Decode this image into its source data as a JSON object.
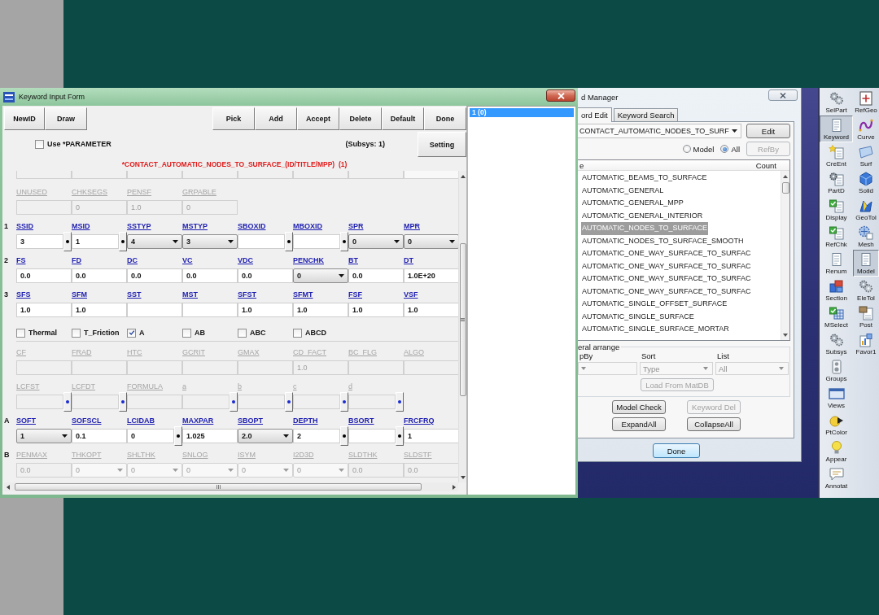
{
  "keyword_input_form": {
    "title": "Keyword Input Form",
    "buttons_left": [
      "NewID",
      "Draw"
    ],
    "buttons_right": [
      "Pick",
      "Add",
      "Accept",
      "Delete",
      "Default",
      "Done"
    ],
    "use_parameter": {
      "label": "Use *PARAMETER",
      "checked": false
    },
    "subsys": "(Subsys: 1)",
    "setting_button": "Setting",
    "keyword_title": "*CONTACT_AUTOMATIC_NODES_TO_SURFACE_(ID/TITLE/MPP)  (1)",
    "sections": [
      {
        "kind": "clipped",
        "fields": [
          {
            "kind": "text"
          },
          {
            "kind": "text"
          },
          {
            "kind": "text"
          },
          {
            "kind": "text"
          },
          {
            "kind": "text"
          },
          {
            "kind": "text"
          },
          {
            "kind": "text"
          },
          {
            "kind": "select"
          }
        ]
      },
      {
        "kind": "card",
        "disabled": true,
        "fields": [
          {
            "label": "UNUSED",
            "kind": "text"
          },
          {
            "label": "CHKSEGS",
            "kind": "text",
            "value": "0"
          },
          {
            "label": "PENSF",
            "kind": "text",
            "value": "1.0"
          },
          {
            "label": "GRPABLE",
            "kind": "text",
            "value": "0"
          }
        ]
      },
      {
        "kind": "card",
        "row_label": "1",
        "disabled": false,
        "fields": [
          {
            "label": "SSID",
            "kind": "pick",
            "value": "3"
          },
          {
            "label": "MSID",
            "kind": "pick",
            "value": "1"
          },
          {
            "label": "SSTYP",
            "kind": "select",
            "value": "4"
          },
          {
            "label": "MSTYP",
            "kind": "select",
            "value": "3"
          },
          {
            "label": "SBOXID",
            "kind": "pick"
          },
          {
            "label": "MBOXID",
            "kind": "pick"
          },
          {
            "label": "SPR",
            "kind": "select",
            "value": "0"
          },
          {
            "label": "MPR",
            "kind": "select",
            "value": "0"
          }
        ]
      },
      {
        "kind": "card",
        "row_label": "2",
        "disabled": false,
        "fields": [
          {
            "label": "FS",
            "kind": "text",
            "value": "0.0"
          },
          {
            "label": "FD",
            "kind": "text",
            "value": "0.0"
          },
          {
            "label": "DC",
            "kind": "text",
            "value": "0.0"
          },
          {
            "label": "VC",
            "kind": "text",
            "value": "0.0"
          },
          {
            "label": "VDC",
            "kind": "text",
            "value": "0.0"
          },
          {
            "label": "PENCHK",
            "kind": "select",
            "value": "0"
          },
          {
            "label": "BT",
            "kind": "text",
            "value": "0.0"
          },
          {
            "label": "DT",
            "kind": "text",
            "value": "1.0E+20"
          }
        ]
      },
      {
        "kind": "card",
        "row_label": "3",
        "disabled": false,
        "fields": [
          {
            "label": "SFS",
            "kind": "text",
            "value": "1.0"
          },
          {
            "label": "SFM",
            "kind": "text",
            "value": "1.0"
          },
          {
            "label": "SST",
            "kind": "text"
          },
          {
            "label": "MST",
            "kind": "text"
          },
          {
            "label": "SFST",
            "kind": "text",
            "value": "1.0"
          },
          {
            "label": "SFMT",
            "kind": "text",
            "value": "1.0"
          },
          {
            "label": "FSF",
            "kind": "text",
            "value": "1.0"
          },
          {
            "label": "VSF",
            "kind": "text",
            "value": "1.0"
          }
        ]
      },
      {
        "kind": "options",
        "items": [
          {
            "label": "Thermal",
            "checked": false
          },
          {
            "label": "T_Friction",
            "checked": false
          },
          {
            "label": "A",
            "checked": true
          },
          {
            "label": "AB",
            "checked": false
          },
          {
            "label": "ABC",
            "checked": false
          },
          {
            "label": "ABCD",
            "checked": false
          }
        ]
      },
      {
        "kind": "card",
        "disabled": true,
        "fields": [
          {
            "label": "CF",
            "kind": "text"
          },
          {
            "label": "FRAD",
            "kind": "text"
          },
          {
            "label": "HTC",
            "kind": "text"
          },
          {
            "label": "GCRIT",
            "kind": "text"
          },
          {
            "label": "GMAX",
            "kind": "text"
          },
          {
            "label": "CD_FACT",
            "kind": "text",
            "value": "1.0"
          },
          {
            "label": "BC_FLG",
            "kind": "text"
          },
          {
            "label": "ALGO",
            "kind": "text"
          }
        ]
      },
      {
        "kind": "card",
        "disabled": true,
        "fields": [
          {
            "label": "LCFST",
            "kind": "pick"
          },
          {
            "label": "LCFDT",
            "kind": "pick"
          },
          {
            "label": "FORMULA",
            "kind": "text"
          },
          {
            "label": "a",
            "kind": "pick"
          },
          {
            "label": "b",
            "kind": "pick"
          },
          {
            "label": "c",
            "kind": "pick"
          },
          {
            "label": "d",
            "kind": "pick"
          }
        ]
      },
      {
        "kind": "card",
        "row_label": "A",
        "disabled": false,
        "fields": [
          {
            "label": "SOFT",
            "kind": "select",
            "value": "1"
          },
          {
            "label": "SOFSCL",
            "kind": "text",
            "value": "0.1"
          },
          {
            "label": "LCIDAB",
            "kind": "pick",
            "value": "0"
          },
          {
            "label": "MAXPAR",
            "kind": "text",
            "value": "1.025"
          },
          {
            "label": "SBOPT",
            "kind": "select",
            "value": "2.0"
          },
          {
            "label": "DEPTH",
            "kind": "pick",
            "value": "2"
          },
          {
            "label": "BSORT",
            "kind": "pick"
          },
          {
            "label": "FRCFRQ",
            "kind": "text",
            "value": "1"
          }
        ]
      },
      {
        "kind": "card",
        "row_label": "B",
        "disabled": true,
        "fields": [
          {
            "label": "PENMAX",
            "kind": "text",
            "value": "0.0"
          },
          {
            "label": "THKOPT",
            "kind": "select",
            "value": "0"
          },
          {
            "label": "SHLTHK",
            "kind": "select",
            "value": "0"
          },
          {
            "label": "SNLOG",
            "kind": "select",
            "value": "0"
          },
          {
            "label": "ISYM",
            "kind": "select",
            "value": "0"
          },
          {
            "label": "I2D3D",
            "kind": "select",
            "value": "0"
          },
          {
            "label": "SLDTHK",
            "kind": "text",
            "value": "0.0"
          },
          {
            "label": "SLDSTF",
            "kind": "text",
            "value": "0.0"
          }
        ]
      }
    ],
    "id_list": [
      {
        "label": "1 (0)",
        "selected": true
      }
    ]
  },
  "keyword_manager": {
    "title": "d Manager",
    "tabs": [
      {
        "label": "ord Edit",
        "selected": true
      },
      {
        "label": "Keyword Search",
        "selected": false
      }
    ],
    "keyword_select": "CONTACT_AUTOMATIC_NODES_TO_SURF",
    "edit_button": "Edit",
    "filter": [
      {
        "label": "Model",
        "selected": false
      },
      {
        "label": "All",
        "selected": true
      }
    ],
    "refby_button": {
      "label": "RefBy",
      "disabled": true
    },
    "list": {
      "columns": [
        "e",
        "Count"
      ],
      "rows": [
        {
          "label": "AUTOMATIC_BEAMS_TO_SURFACE",
          "selected": false
        },
        {
          "label": "AUTOMATIC_GENERAL",
          "selected": false
        },
        {
          "label": "AUTOMATIC_GENERAL_MPP",
          "selected": false
        },
        {
          "label": "AUTOMATIC_GENERAL_INTERIOR",
          "selected": false
        },
        {
          "label": "AUTOMATIC_NODES_TO_SURFACE",
          "selected": true
        },
        {
          "label": "AUTOMATIC_NODES_TO_SURFACE_SMOOTH",
          "selected": false
        },
        {
          "label": "AUTOMATIC_ONE_WAY_SURFACE_TO_SURFAC",
          "selected": false
        },
        {
          "label": "AUTOMATIC_ONE_WAY_SURFACE_TO_SURFAC",
          "selected": false
        },
        {
          "label": "AUTOMATIC_ONE_WAY_SURFACE_TO_SURFAC",
          "selected": false
        },
        {
          "label": "AUTOMATIC_ONE_WAY_SURFACE_TO_SURFAC",
          "selected": false
        },
        {
          "label": "AUTOMATIC_SINGLE_OFFSET_SURFACE",
          "selected": false
        },
        {
          "label": "AUTOMATIC_SINGLE_SURFACE",
          "selected": false
        },
        {
          "label": "AUTOMATIC_SINGLE_SURFACE_MORTAR",
          "selected": false
        }
      ]
    },
    "arrange": {
      "title": "eral arrange",
      "fields": [
        {
          "label": "pBy",
          "disabled": true
        },
        {
          "label": "Sort",
          "value": "Type",
          "disabled": true
        },
        {
          "label": "List",
          "value": "All",
          "disabled": true
        }
      ],
      "load_button": {
        "label": "Load From MatDB",
        "disabled": true
      }
    },
    "buttons": [
      {
        "label": "Model Check",
        "disabled": false
      },
      {
        "label": "Keyword Del",
        "disabled": true
      },
      {
        "label": "ExpandAll",
        "disabled": false
      },
      {
        "label": "CollapseAll",
        "disabled": false
      }
    ],
    "done_button": "Done"
  },
  "toolbar": {
    "left": [
      {
        "label": "SelPart",
        "selected": false
      },
      {
        "label": "Keyword",
        "selected": true
      },
      {
        "label": "CreEnt",
        "selected": false
      },
      {
        "label": "PartD",
        "selected": false
      },
      {
        "label": "Display",
        "selected": false
      },
      {
        "label": "RefChk",
        "selected": false
      },
      {
        "label": "Renum",
        "selected": false
      },
      {
        "label": "Section",
        "selected": false
      },
      {
        "label": "MSelect",
        "selected": false
      },
      {
        "label": "Subsys",
        "selected": false
      },
      {
        "label": "Groups",
        "selected": false
      },
      {
        "label": "Views",
        "selected": false
      },
      {
        "label": "PtColor",
        "selected": false
      },
      {
        "label": "Appear",
        "selected": false
      },
      {
        "label": "Annotat",
        "selected": false
      }
    ],
    "right": [
      {
        "label": "RefGeo",
        "selected": false
      },
      {
        "label": "Curve",
        "selected": false
      },
      {
        "label": "Surf",
        "selected": false
      },
      {
        "label": "Solid",
        "selected": false
      },
      {
        "label": "GeoTol",
        "selected": false
      },
      {
        "label": "Mesh",
        "selected": false
      },
      {
        "label": "Model",
        "selected": true
      },
      {
        "label": "EleTol",
        "selected": false
      },
      {
        "label": "Post",
        "selected": false
      },
      {
        "label": "Favor1",
        "selected": false
      }
    ]
  }
}
